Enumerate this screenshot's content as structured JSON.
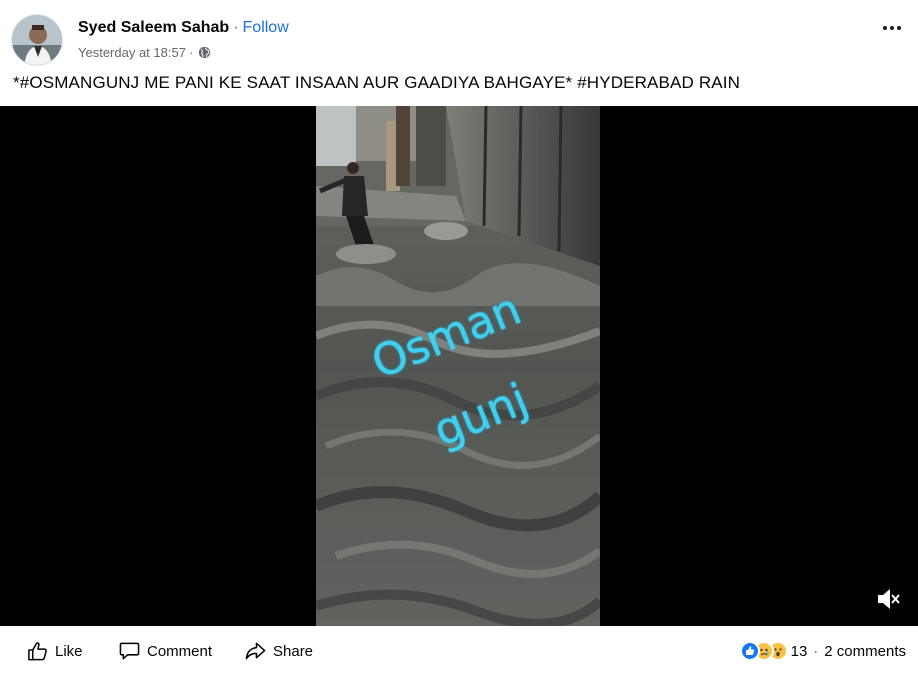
{
  "author": {
    "name": "Syed Saleem Sahab",
    "follow_label": "Follow",
    "separator": "·"
  },
  "meta": {
    "timestamp": "Yesterday at 18:57",
    "separator": "·",
    "audience_icon": "globe-icon"
  },
  "more_icon": "more-options-icon",
  "caption": "*#OSMANGUNJ ME PANI KE SAAT INSAAN AUR GAADIYA BAHGAYE* #HYDERABAD RAIN",
  "video": {
    "overlay_line1": "Osman",
    "overlay_line2": "gunj",
    "mute_icon": "volume-muted-icon"
  },
  "actions": {
    "like_label": "Like",
    "comment_label": "Comment",
    "share_label": "Share"
  },
  "reactions": {
    "icons": [
      "like-reaction-icon",
      "sad-reaction-icon",
      "wow-reaction-icon"
    ],
    "count": "13",
    "separator": "·",
    "comments": "2 comments"
  },
  "colors": {
    "link": "#216fdb",
    "secondary_text": "#65676b",
    "overlay_text": "#3fd0f0",
    "like_blue": "#1877f2"
  }
}
